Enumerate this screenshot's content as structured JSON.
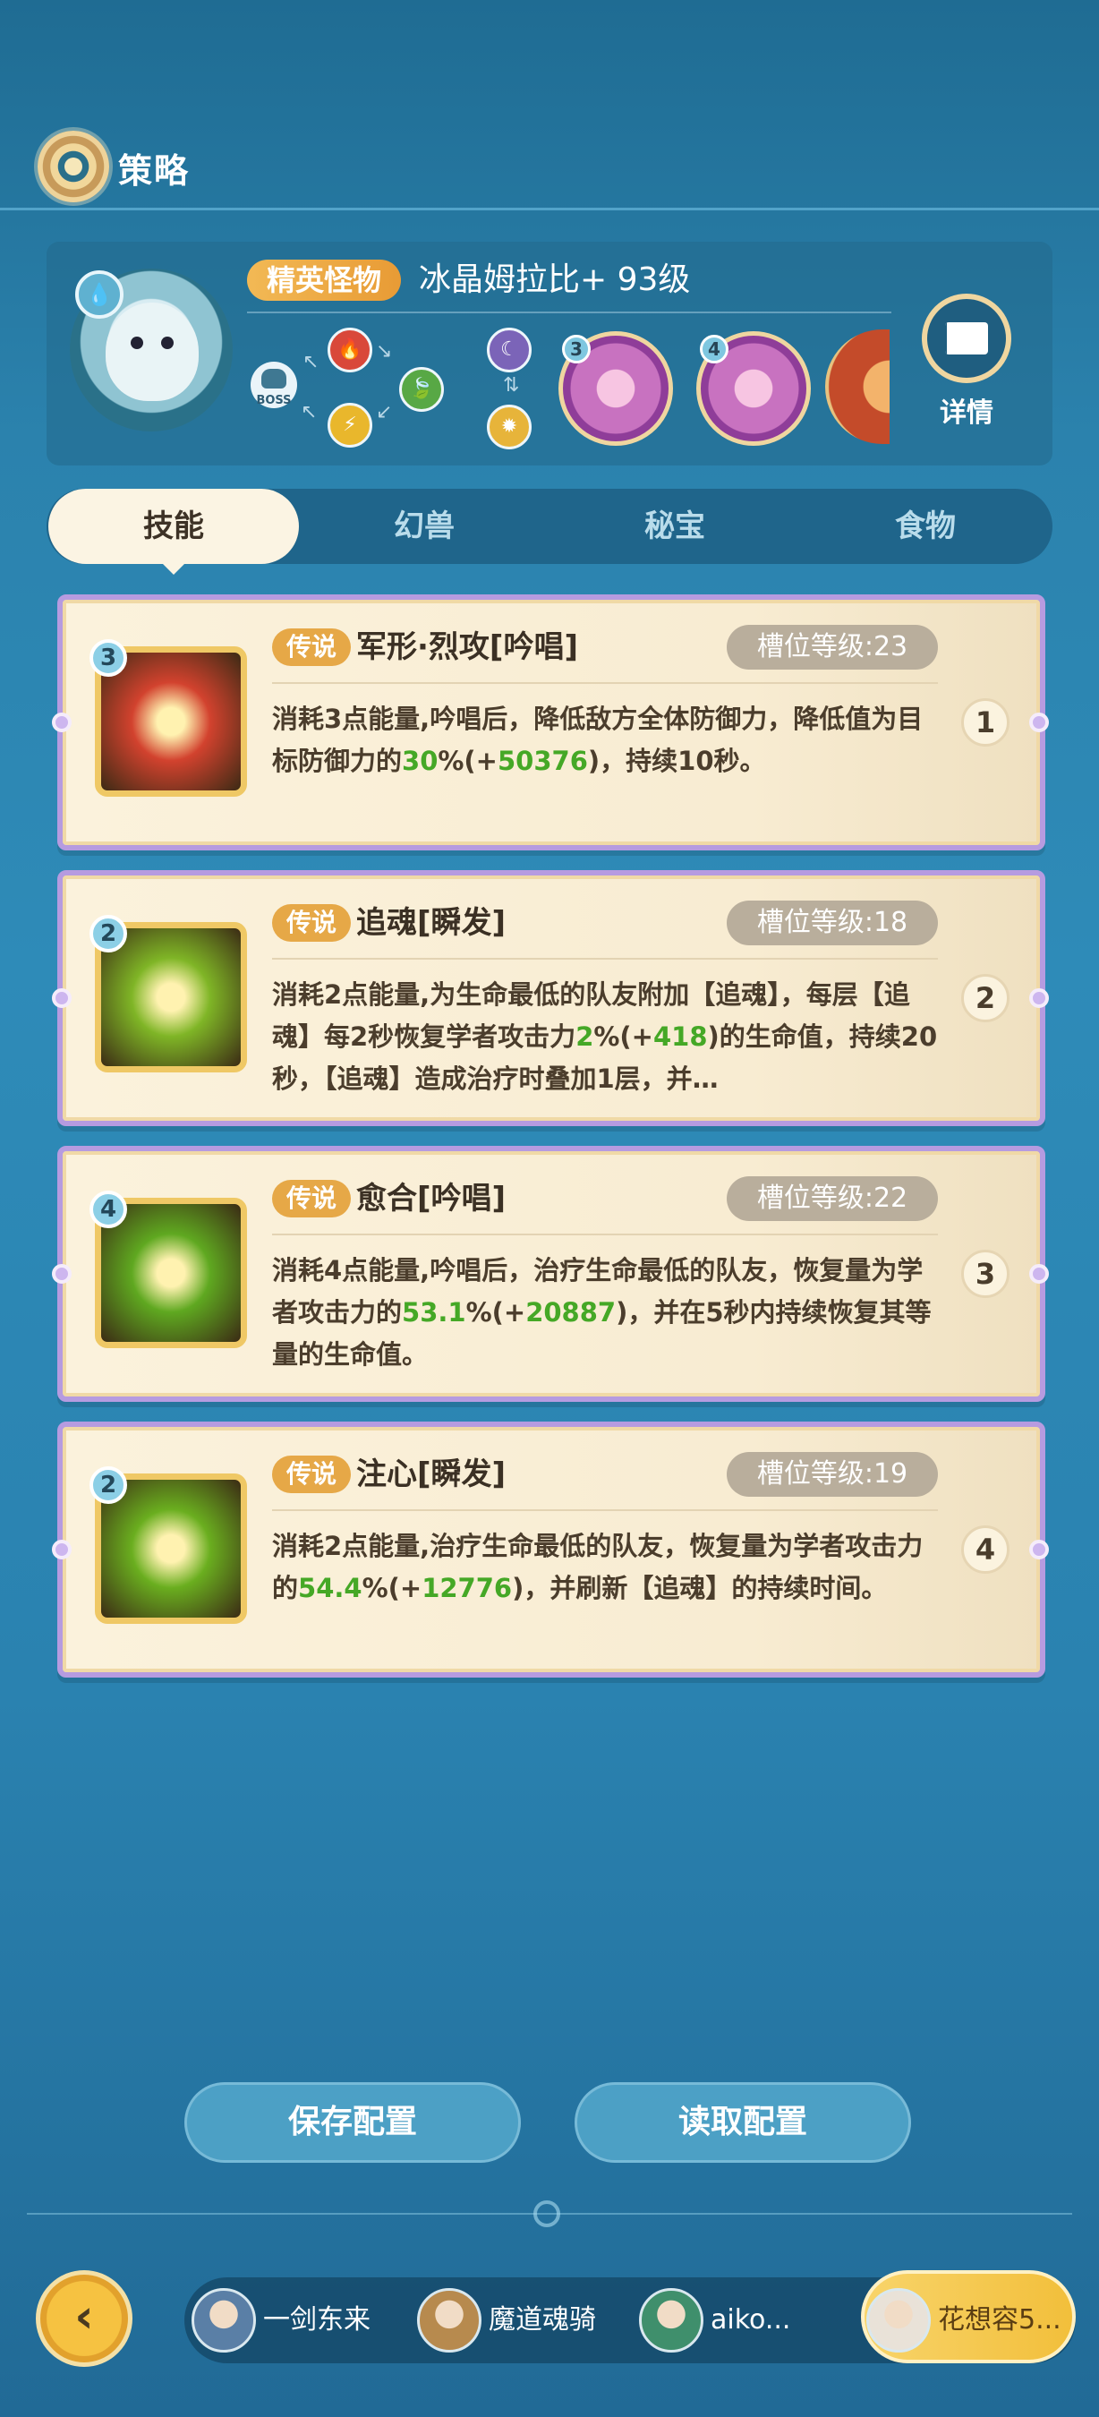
{
  "header": {
    "title": "策略",
    "icon": "gear-icon"
  },
  "monster": {
    "tag": "精英怪物",
    "name": "冰晶姆拉比+ 93级",
    "boss_label": "BOSS",
    "details_label": "详情",
    "pets": [
      {
        "num": "3"
      },
      {
        "num": "4"
      }
    ]
  },
  "tabs": [
    "技能",
    "幻兽",
    "秘宝",
    "食物"
  ],
  "active_tab": "技能",
  "skills": [
    {
      "num": "3",
      "tag": "传说",
      "name": "军形·烈攻[吟唱]",
      "slot": "槽位等级:23",
      "order": "1",
      "desc_pre": "消耗3点能量,吟唱后，降低敌方全体防御力，降低值为目标防御力的",
      "desc_g1": "30",
      "desc_m1": "%(+",
      "desc_g2": "50376",
      "desc_post": ")，持续10秒。",
      "icon_color": "#d2422e"
    },
    {
      "num": "2",
      "tag": "传说",
      "name": "追魂[瞬发]",
      "slot": "槽位等级:18",
      "order": "2",
      "desc_pre": "消耗2点能量,为生命最低的队友附加【追魂】，每层【追魂】每2秒恢复学者攻击力",
      "desc_g1": "2",
      "desc_m1": "%(+",
      "desc_g2": "418",
      "desc_post": ")的生命值，持续20秒，【追魂】造成治疗时叠加1层，并…",
      "icon_color": "#7fb526"
    },
    {
      "num": "4",
      "tag": "传说",
      "name": "愈合[吟唱]",
      "slot": "槽位等级:22",
      "order": "3",
      "desc_pre": "消耗4点能量,吟唱后，治疗生命最低的队友，恢复量为学者攻击力的",
      "desc_g1": "53.1",
      "desc_m1": "%(+",
      "desc_g2": "20887",
      "desc_post": ")，并在5秒内持续恢复其等量的生命值。",
      "icon_color": "#5fa820"
    },
    {
      "num": "2",
      "tag": "传说",
      "name": "注心[瞬发]",
      "slot": "槽位等级:19",
      "order": "4",
      "desc_pre": "消耗2点能量,治疗生命最低的队友，恢复量为学者攻击力的",
      "desc_g1": "54.4",
      "desc_m1": "%(+",
      "desc_g2": "12776",
      "desc_post": ")，并刷新【追魂】的持续时间。",
      "icon_color": "#6aae1f"
    }
  ],
  "buttons": {
    "save": "保存配置",
    "load": "读取配置"
  },
  "team": [
    {
      "name": "一剑东来",
      "color": "#5a7fa6"
    },
    {
      "name": "魔道魂骑",
      "color": "#b78a4e"
    },
    {
      "name": "aiko...",
      "color": "#3f8f6c"
    },
    {
      "name": "花想容5...",
      "color": "#e9e2d8"
    }
  ]
}
